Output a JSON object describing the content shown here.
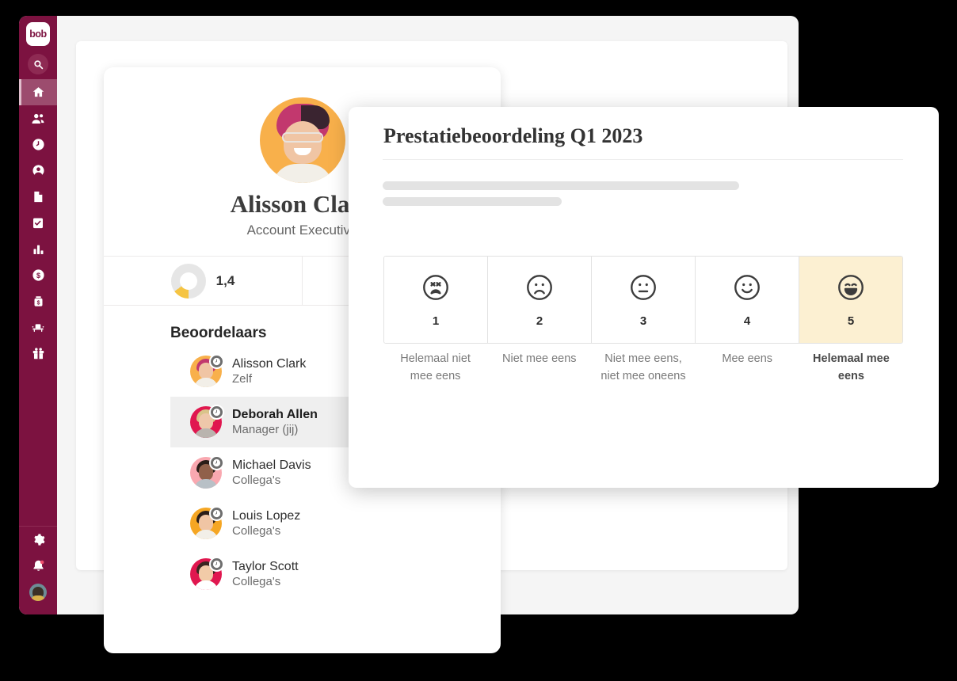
{
  "sidebar": {
    "logo_text": "bob",
    "search_label": "Search",
    "items": [
      {
        "name": "home",
        "icon": "home-icon",
        "active": true
      },
      {
        "name": "people",
        "icon": "people-icon",
        "active": false
      },
      {
        "name": "time",
        "icon": "clock-icon",
        "active": false
      },
      {
        "name": "profile",
        "icon": "user-circle-icon",
        "active": false
      },
      {
        "name": "documents",
        "icon": "document-icon",
        "active": false
      },
      {
        "name": "tasks",
        "icon": "task-checklist-icon",
        "active": false
      },
      {
        "name": "analytics",
        "icon": "bar-chart-icon",
        "active": false
      },
      {
        "name": "compensation",
        "icon": "dollar-circle-icon",
        "active": false
      },
      {
        "name": "payroll",
        "icon": "money-bag-icon",
        "active": false
      },
      {
        "name": "workspace",
        "icon": "desk-icon",
        "active": false
      },
      {
        "name": "benefits",
        "icon": "gift-icon",
        "active": false
      }
    ],
    "bottom_items": [
      {
        "name": "settings",
        "icon": "gear-icon"
      },
      {
        "name": "notifications",
        "icon": "bell-icon"
      },
      {
        "name": "account",
        "icon": "user-avatar"
      }
    ]
  },
  "profile": {
    "avatar_name": "alisson-clark-avatar",
    "name": "Alisson Clark",
    "role": "Account Executive",
    "stats": [
      {
        "name": "score",
        "value": "1,4",
        "icon": "donut-progress",
        "progress_pct": 15
      },
      {
        "name": "goals",
        "value": "",
        "icon": "target-icon"
      }
    ],
    "reviewers_heading": "Beoordelaars",
    "reviewers": [
      {
        "name": "Alisson Clark",
        "role": "Zelf",
        "selected": false,
        "status_icon": "clock-icon",
        "bg": "#f8b04b",
        "hair": "#c2386e",
        "skin": "#f0c5a4",
        "body": "#f2efe8"
      },
      {
        "name": "Deborah Allen",
        "role": "Manager (jij)",
        "selected": true,
        "status_icon": "clock-icon",
        "bg": "#e0174f",
        "hair": "#d9c48a",
        "skin": "#eec7aa",
        "body": "#b9b4ae"
      },
      {
        "name": "Michael Davis",
        "role": "Collega's",
        "selected": false,
        "status_icon": "clock-icon",
        "bg": "#f9a8b0",
        "hair": "#2a1d18",
        "skin": "#90604a",
        "body": "#b8c0c6"
      },
      {
        "name": "Louis Lopez",
        "role": "Collega's",
        "selected": false,
        "status_icon": "clock-icon",
        "bg": "#f5a623",
        "hair": "#2a1d18",
        "skin": "#f0c5a4",
        "body": "#f2efe8"
      },
      {
        "name": "Taylor Scott",
        "role": "Collega's",
        "selected": false,
        "status_icon": "clock-icon",
        "bg": "#e0174f",
        "hair": "#3a2620",
        "skin": "#f2cba8",
        "body": "#ffffff"
      }
    ]
  },
  "modal": {
    "title": "Prestatiebeoordeling Q1 2023",
    "scale": [
      {
        "value": "1",
        "caption": "Helemaal niet mee eens",
        "face": "very-sad-face-icon",
        "selected": false
      },
      {
        "value": "2",
        "caption": "Niet mee eens",
        "face": "sad-face-icon",
        "selected": false
      },
      {
        "value": "3",
        "caption": "Niet mee eens, niet mee oneens",
        "face": "neutral-face-icon",
        "selected": false
      },
      {
        "value": "4",
        "caption": "Mee eens",
        "face": "happy-face-icon",
        "selected": false
      },
      {
        "value": "5",
        "caption": "Helemaal mee eens",
        "face": "very-happy-face-icon",
        "selected": true
      }
    ],
    "selected_value": "5",
    "accent_color": "#fcf0d2"
  },
  "colors": {
    "sidebar_bg": "#7c1240",
    "sidebar_active": "#9c4c6e",
    "app_bg": "#f5f5f5",
    "selected_highlight": "#fcf0d2"
  }
}
